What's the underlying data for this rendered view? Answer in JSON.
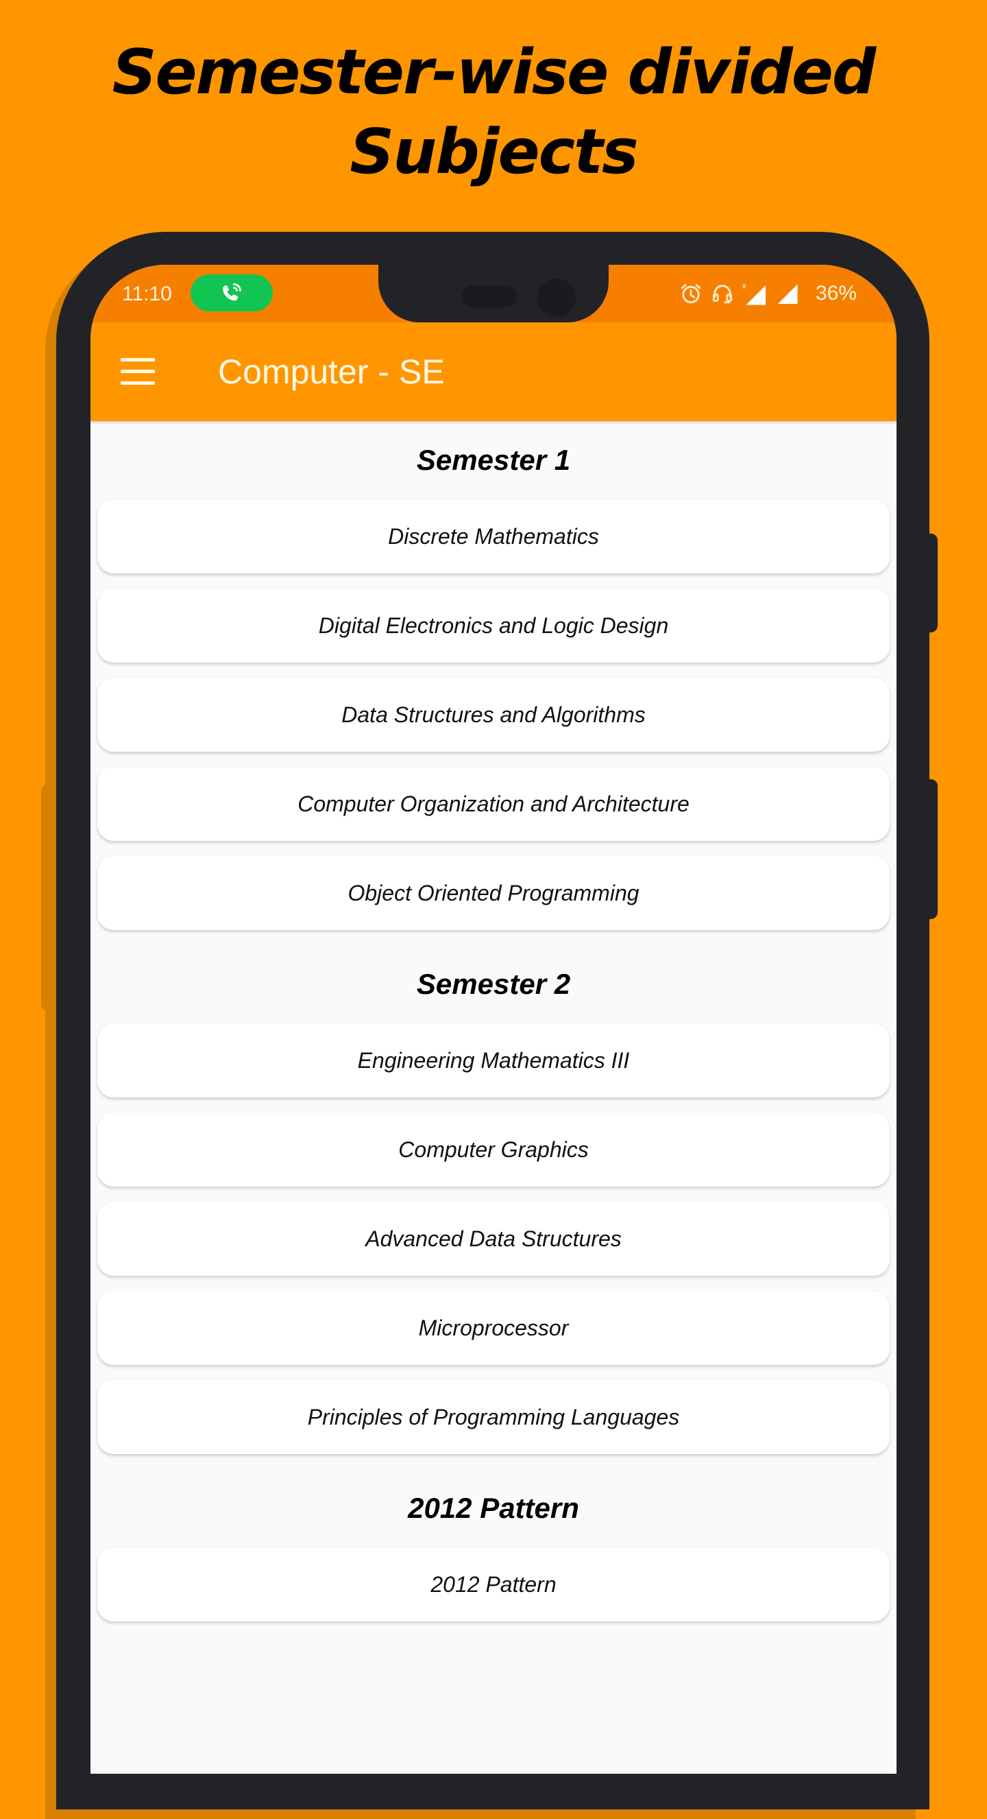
{
  "promo": {
    "title_line1": "Semester-wise divided",
    "title_line2": "Subjects",
    "background_color": "#FF9600"
  },
  "status_bar": {
    "time": "11:10",
    "call_indicator": "phone-call-icon",
    "icons": [
      "alarm-icon",
      "headset-icon",
      "signal-no-data-icon",
      "signal-icon"
    ],
    "battery": "36%",
    "color": "#F77F00"
  },
  "app_bar": {
    "menu_icon": "hamburger-menu-icon",
    "title": "Computer - SE",
    "color": "#FF9600"
  },
  "sections": [
    {
      "title": "Semester 1",
      "subjects": [
        "Discrete Mathematics",
        "Digital Electronics and Logic Design",
        "Data Structures and Algorithms",
        "Computer Organization and Architecture",
        "Object Oriented Programming"
      ]
    },
    {
      "title": "Semester 2",
      "subjects": [
        "Engineering Mathematics III",
        "Computer Graphics",
        "Advanced Data Structures",
        "Microprocessor",
        "Principles of Programming Languages"
      ]
    },
    {
      "title": "2012 Pattern",
      "subjects": [
        "2012 Pattern"
      ]
    }
  ]
}
